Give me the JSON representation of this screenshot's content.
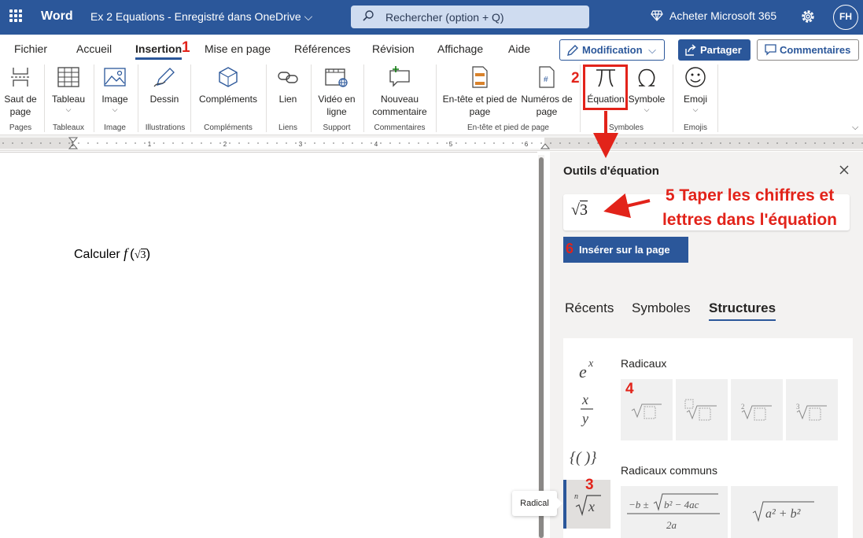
{
  "titlebar": {
    "app_name": "Word",
    "document_title": "Ex 2 Equations  -  Enregistré dans OneDrive",
    "search_placeholder": "Rechercher (option + Q)",
    "buy_label": "Acheter Microsoft 365",
    "avatar_initials": "FH"
  },
  "ribbon_tabs": [
    {
      "label": "Fichier"
    },
    {
      "label": "Accueil"
    },
    {
      "label": "Insertion",
      "active": true
    },
    {
      "label": "Mise en page"
    },
    {
      "label": "Références"
    },
    {
      "label": "Révision"
    },
    {
      "label": "Affichage"
    },
    {
      "label": "Aide"
    }
  ],
  "actions": {
    "modification_label": "Modification",
    "share_label": "Partager",
    "comments_label": "Commentaires"
  },
  "ribbon": {
    "buttons": {
      "page_break": "Saut de page",
      "table": "Tableau",
      "image": "Image",
      "drawing": "Dessin",
      "addins": "Compléments",
      "link": "Lien",
      "video": "Vidéo en ligne",
      "new_comment": "Nouveau commentaire",
      "header_footer": "En-tête et pied de page",
      "page_numbers": "Numéros de page",
      "equation": "Équation",
      "symbol": "Symbole",
      "emoji": "Emoji"
    },
    "groups": {
      "pages": "Pages",
      "tables": "Tableaux",
      "image": "Image",
      "illustrations": "Illustrations",
      "addins": "Compléments",
      "links": "Liens",
      "support": "Support",
      "comments": "Commentaires",
      "header_footer": "En-tête et pied de page",
      "symbols": "Symboles",
      "emojis": "Emojis"
    }
  },
  "ruler": {
    "numbers": [
      "1",
      "1",
      "2",
      "3",
      "4",
      "5",
      "6"
    ]
  },
  "document": {
    "text_before": "Calculer ",
    "function_name": "f",
    "open_paren": "(",
    "radical_value": "3",
    "close_paren": ")"
  },
  "equation_pane": {
    "title": "Outils d'équation",
    "input_radical_value": "3",
    "insert_label": "Insérer sur la page",
    "tabs": [
      {
        "label": "Récents"
      },
      {
        "label": "Symboles"
      },
      {
        "label": "Structures",
        "active": true
      }
    ],
    "section_radicals": "Radicaux",
    "section_common_radicals": "Radicaux communs",
    "tooltip": "Radical"
  },
  "annotations": {
    "step1": "1",
    "step2": "2",
    "step3": "3",
    "step4": "4",
    "step5_text": "5 Taper les chiffres et lettres dans l'équation",
    "step6": "6"
  },
  "colors": {
    "word_blue": "#2b579a",
    "annotation_red": "#e2231a",
    "pane_bg": "#f3f2f1"
  }
}
